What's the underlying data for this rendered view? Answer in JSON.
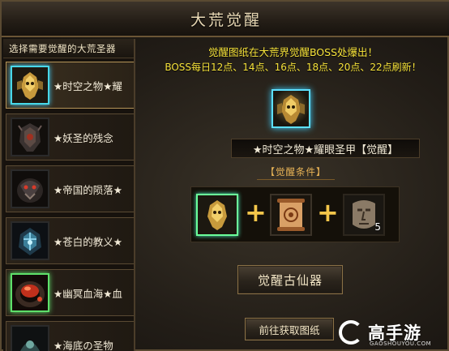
{
  "window": {
    "title": "大荒觉醒"
  },
  "sidebar": {
    "header": "选择需要觉醒的大荒圣器",
    "items": [
      {
        "label": "★时空之物★耀",
        "icon": "golden-mask-armor-icon",
        "selected": true
      },
      {
        "label": "★妖圣的残念",
        "icon": "dark-armor-icon",
        "selected": false
      },
      {
        "label": "★帝国的陨落★",
        "icon": "dark-dragon-armor-icon",
        "selected": false
      },
      {
        "label": "★苍白的教义★",
        "icon": "blue-crystal-helmet-icon",
        "selected": false
      },
      {
        "label": "★幽冥血海★血",
        "icon": "blood-ring-icon",
        "selected": false
      },
      {
        "label": "★海底の圣物",
        "icon": "sea-relic-icon",
        "selected": false
      }
    ]
  },
  "main": {
    "notice_line1": "觉醒图纸在大荒界觉醒BOSS处爆出！",
    "notice_line2": "BOSS每日12点、14点、16点、18点、20点、22点刷新！",
    "item_name": "★时空之物★耀眼圣甲【觉醒】",
    "conditions_heading": "【觉醒条件】",
    "materials": [
      {
        "icon": "golden-mask-armor-icon",
        "count": ""
      },
      {
        "icon": "scroll-blueprint-icon",
        "count": ""
      },
      {
        "icon": "stone-face-icon",
        "count": "5"
      }
    ],
    "awaken_button": "觉醒古仙器",
    "fetch_button": "前往获取图纸"
  },
  "watermark": {
    "brand": "高手游",
    "domain": "GAOSHOUYOU.COM"
  },
  "colors": {
    "notice": "#f6e23a",
    "accent_gold": "#e8b356",
    "glow_cyan": "#3fd0ff"
  }
}
